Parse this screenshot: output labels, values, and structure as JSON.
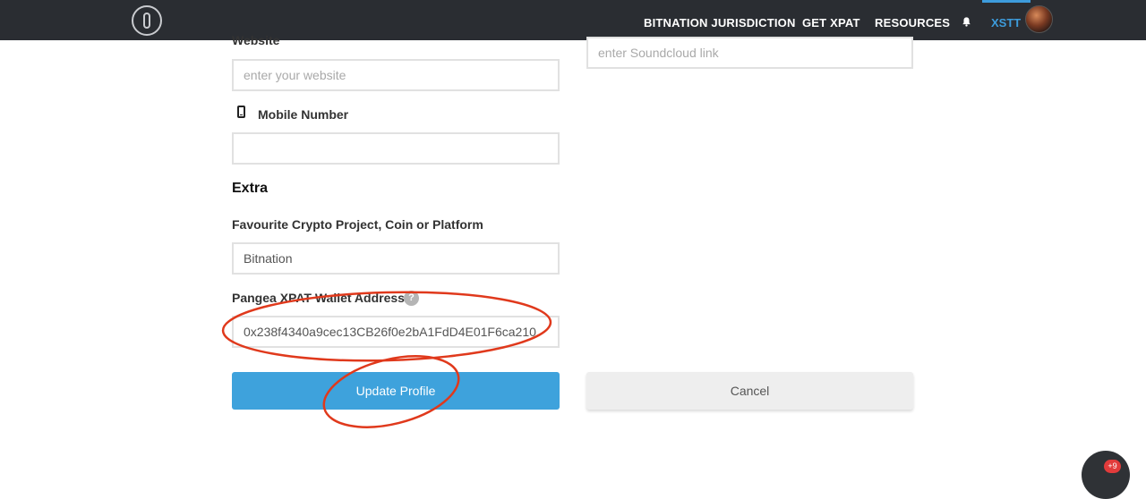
{
  "nav": {
    "items": [
      {
        "label": "BITNATION JURISDICTION"
      },
      {
        "label": "GET XPAT"
      },
      {
        "label": "RESOURCES"
      }
    ],
    "user_label": "XSTT",
    "accent_color": "#3d9cdc"
  },
  "form": {
    "website": {
      "label": "Website",
      "placeholder": "enter your website",
      "value": ""
    },
    "soundcloud": {
      "placeholder": "enter Soundcloud link",
      "value": ""
    },
    "mobile": {
      "label": "Mobile Number",
      "value": "",
      "icon": "phone-icon"
    },
    "extra_title": "Extra",
    "crypto": {
      "label": "Favourite Crypto Project, Coin or Platform",
      "value": "Bitnation"
    },
    "wallet": {
      "label": "Pangea XPAT Wallet Address",
      "help": "?",
      "value": "0x238f4340a9cec13CB26f0e2bA1FdD4E01F6ca210"
    },
    "update_label": "Update Profile",
    "cancel_label": "Cancel"
  },
  "chat": {
    "badge": "+9"
  },
  "colors": {
    "primary_button": "#3ea2dc",
    "annotation_red": "#e0391c",
    "topbar": "#2a2d32"
  }
}
